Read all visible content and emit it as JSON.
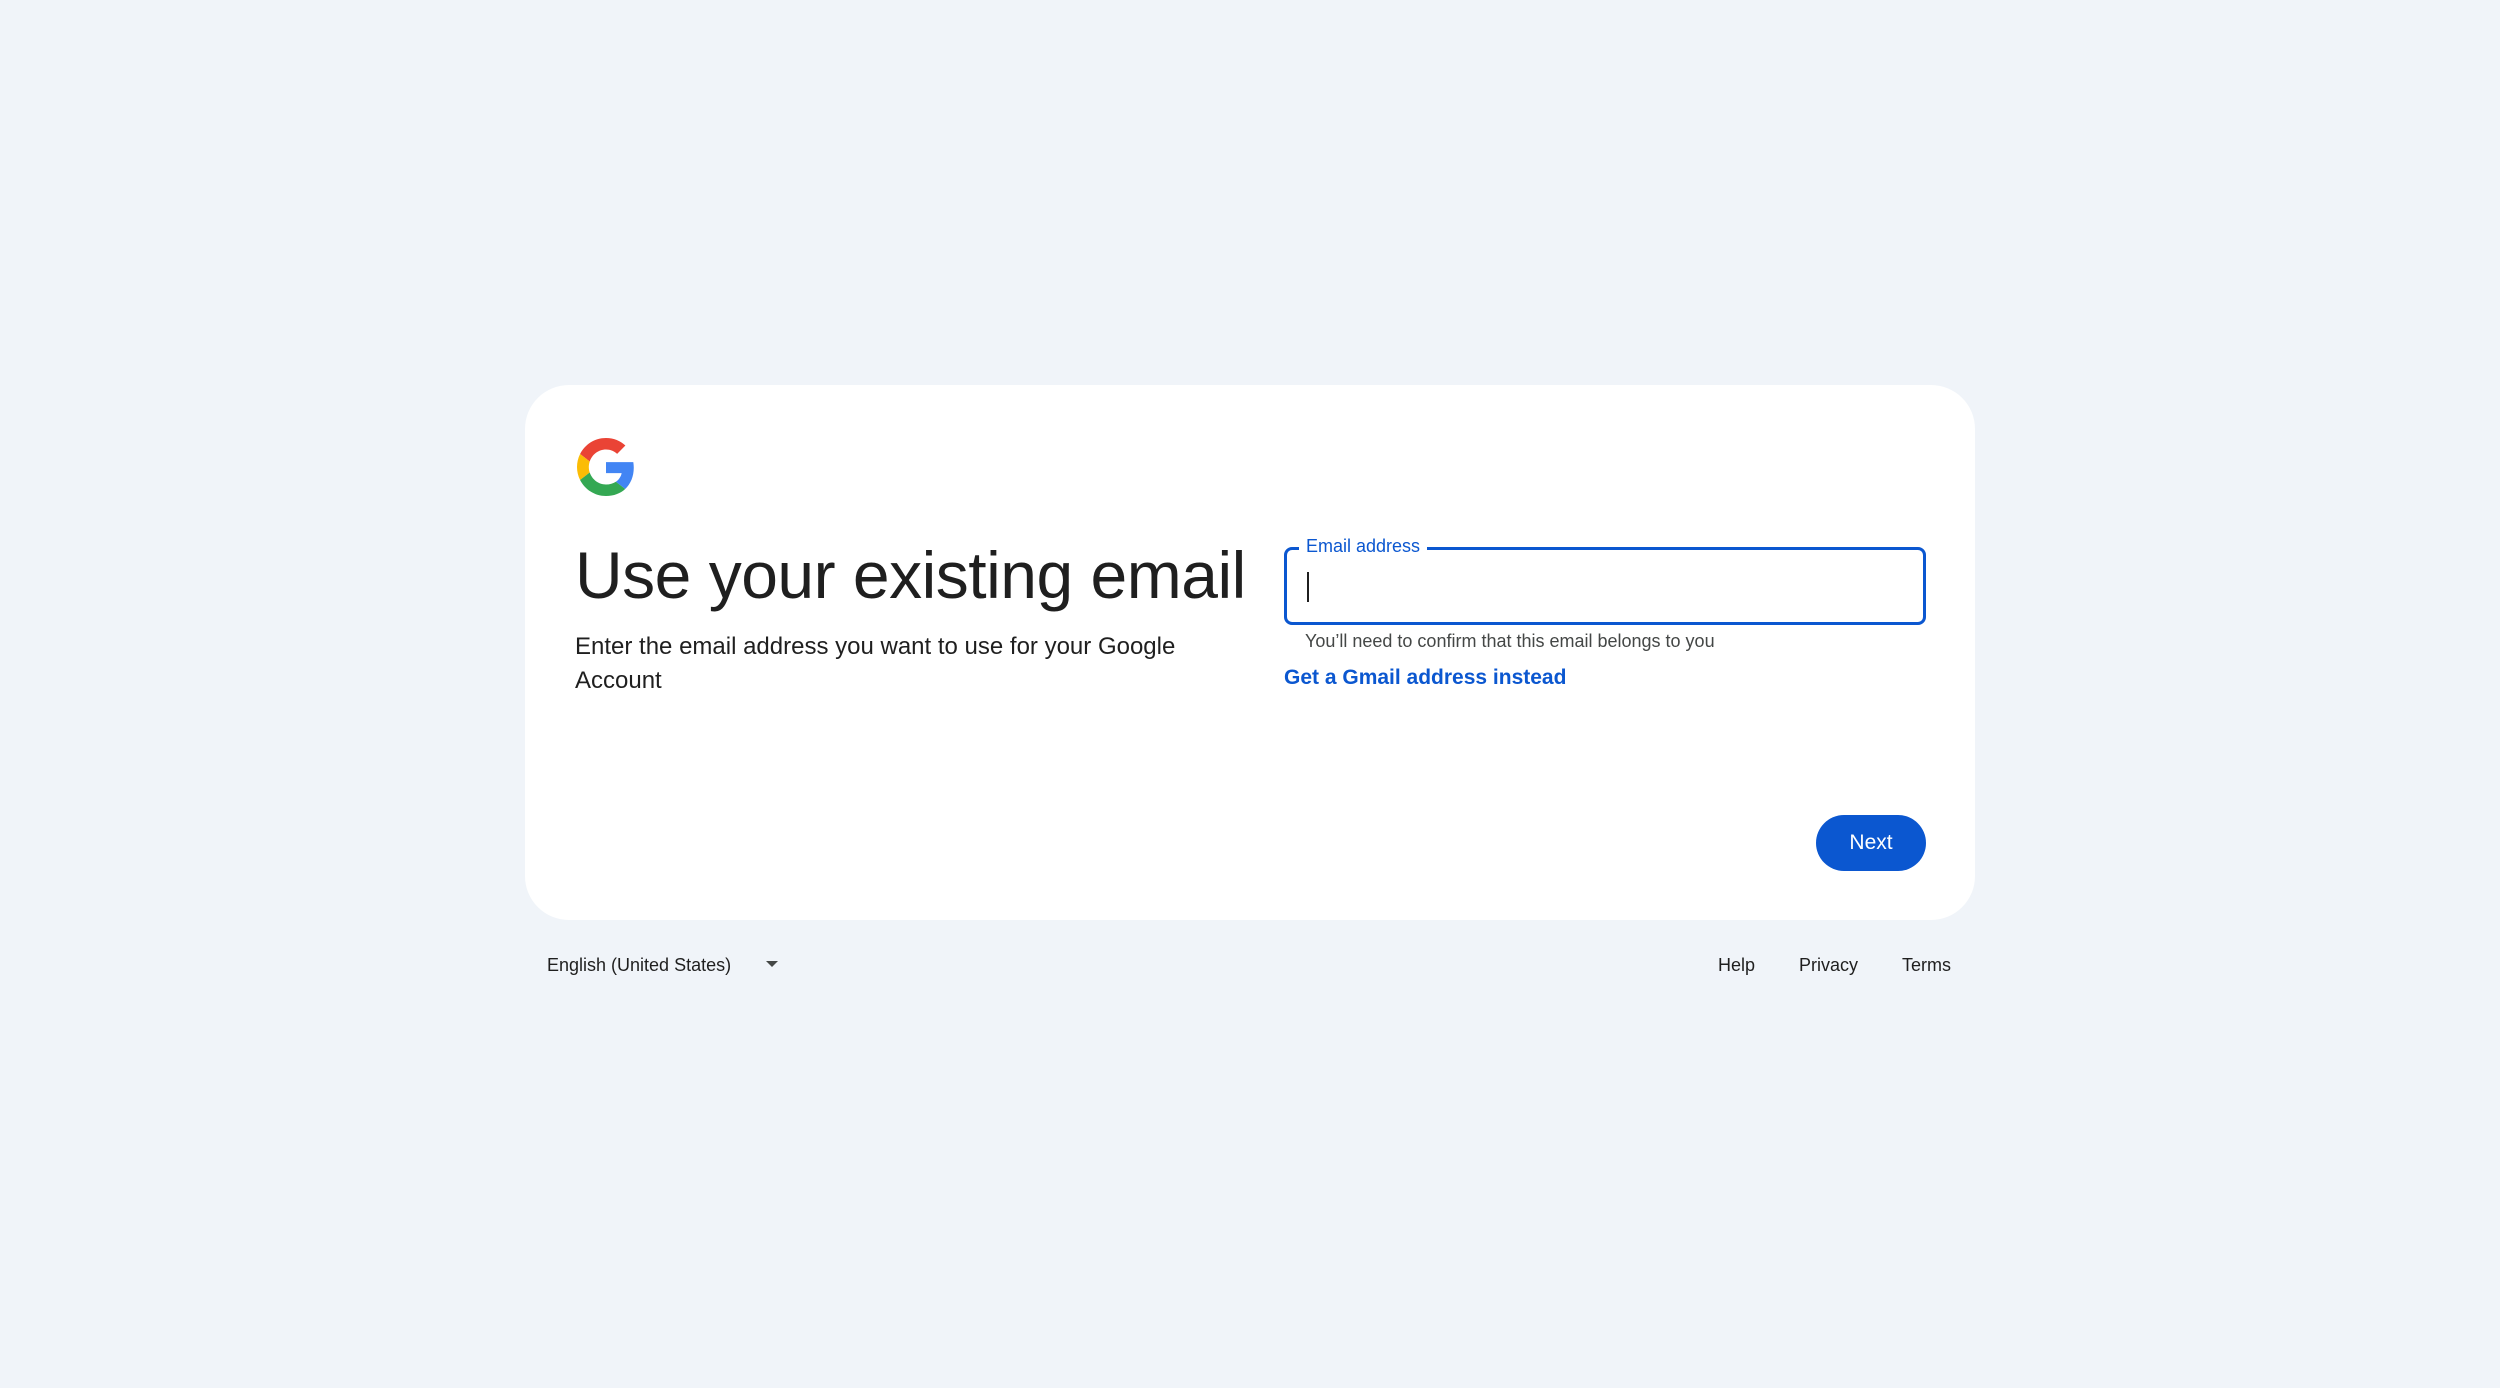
{
  "signup": {
    "title": "Use your existing email",
    "subtitle": "Enter the email address you want to use for your Google Account",
    "email_field": {
      "label": "Email address",
      "value": "",
      "helper_text": "You’ll need to confirm that this email belongs to you"
    },
    "gmail_link": "Get a Gmail address instead",
    "next_label": "Next"
  },
  "footer": {
    "language": "English (United States)",
    "links": [
      "Help",
      "Privacy",
      "Terms"
    ]
  },
  "colors": {
    "background": "#f0f4f9",
    "card": "#ffffff",
    "accent": "#0b57d0",
    "text": "#1f1f1f"
  },
  "icons": {
    "logo": "google-g-logo-icon",
    "language_dropdown": "chevron-down-icon"
  }
}
